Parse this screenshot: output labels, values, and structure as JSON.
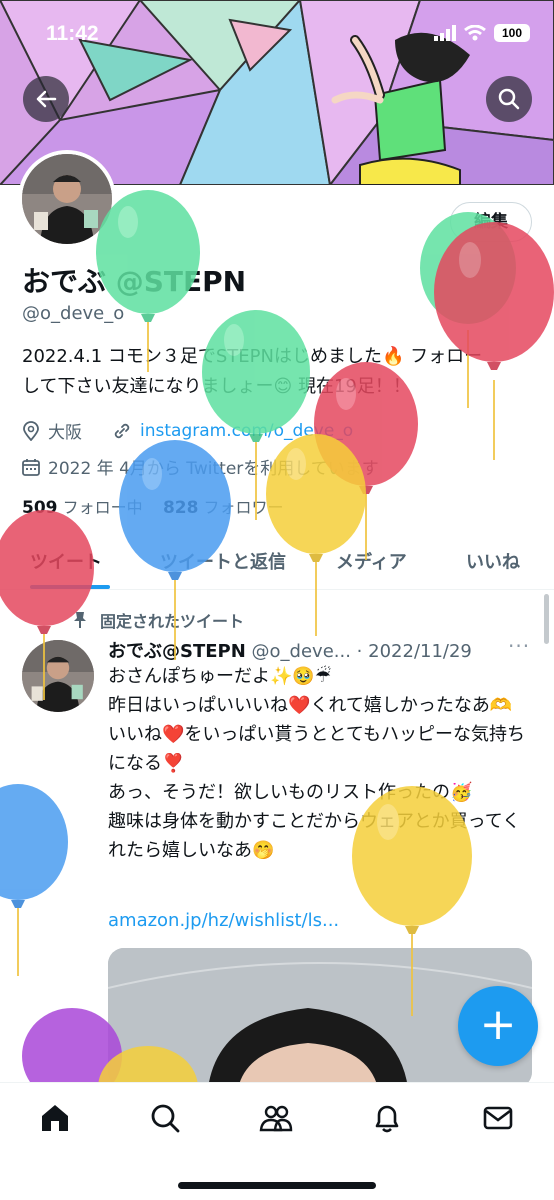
{
  "status_bar": {
    "time": "11:42",
    "battery": "100"
  },
  "profile": {
    "edit_label": "編集",
    "display_name": "おでぶ @STEPN",
    "handle": "@o_deve_o",
    "bio": "2022.4.1 コモン３足でSTEPNはじめました🔥 フォローして下さい友達になりましょー😊 現在19足！！",
    "location": "大阪",
    "website": "instagram.com/o_deve_o",
    "joined": "2022 年 4月から Twitterを利用しています",
    "following_count": "509",
    "following_label": "フォロー中",
    "followers_count": "828",
    "followers_label": "フォロワー"
  },
  "tabs": [
    {
      "label": "ツイート"
    },
    {
      "label": "ツイートと返信"
    },
    {
      "label": "メディア"
    },
    {
      "label": "いいね"
    }
  ],
  "tweet": {
    "pinned_label": "固定されたツイート",
    "author_name": "おでぶ@STEPN",
    "author_handle": "@o_deve...",
    "date": "2022/11/29",
    "separator": "·",
    "more": "···",
    "lines": [
      "おさんぽちゅーだよ✨🥹☔",
      "昨日はいっぱいいいね❤️くれて嬉しかったなあ🫶",
      "いいね❤️をいっぱい貰うととてもハッピーな気持ちになる❣️",
      "あっ、そうだ！欲しいものリスト作ったの🥳",
      "趣味は身体を動かすことだからウェアとか買ってくれたら嬉しいなあ🤭"
    ],
    "link": "amazon.jp/hz/wishlist/ls..."
  },
  "fab_label": "+",
  "colors": {
    "accent": "#1d9bf0",
    "text_primary": "#0f1419",
    "text_secondary": "#536471",
    "balloon_green": "#5ee0a0",
    "balloon_red": "#e5485f",
    "balloon_yellow": "#f5cf3a",
    "balloon_blue": "#4a9cf0",
    "balloon_purple": "#a946d8"
  },
  "icons": [
    "back-arrow-icon",
    "search-icon",
    "location-pin-icon",
    "link-icon",
    "calendar-icon",
    "pin-icon",
    "home-icon",
    "explore-icon",
    "communities-icon",
    "notifications-icon",
    "messages-icon"
  ]
}
